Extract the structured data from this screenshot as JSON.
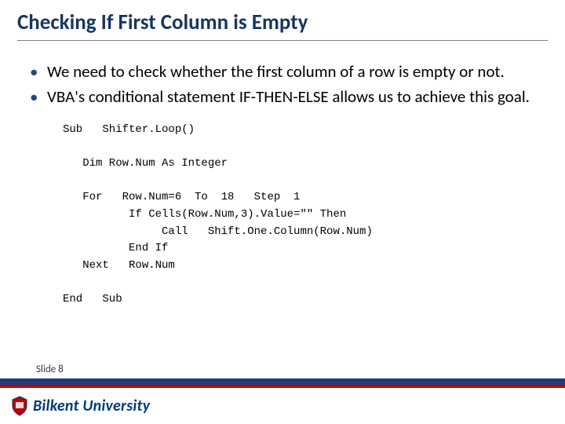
{
  "title": "Checking If First Column is Empty",
  "bullets": [
    "We need to check whether the first column of a row is empty or not.",
    "VBA's conditional statement IF-THEN-ELSE allows us to achieve this  goal."
  ],
  "code": "Sub   Shifter.Loop()\n\n   Dim Row.Num As Integer\n\n   For   Row.Num=6  To  18   Step  1\n          If Cells(Row.Num,3).Value=\"\" Then\n               Call   Shift.One.Column(Row.Num)\n          End If\n   Next   Row.Num\n\nEnd   Sub",
  "slide_label": "Slide 8",
  "university": "Bilkent University"
}
